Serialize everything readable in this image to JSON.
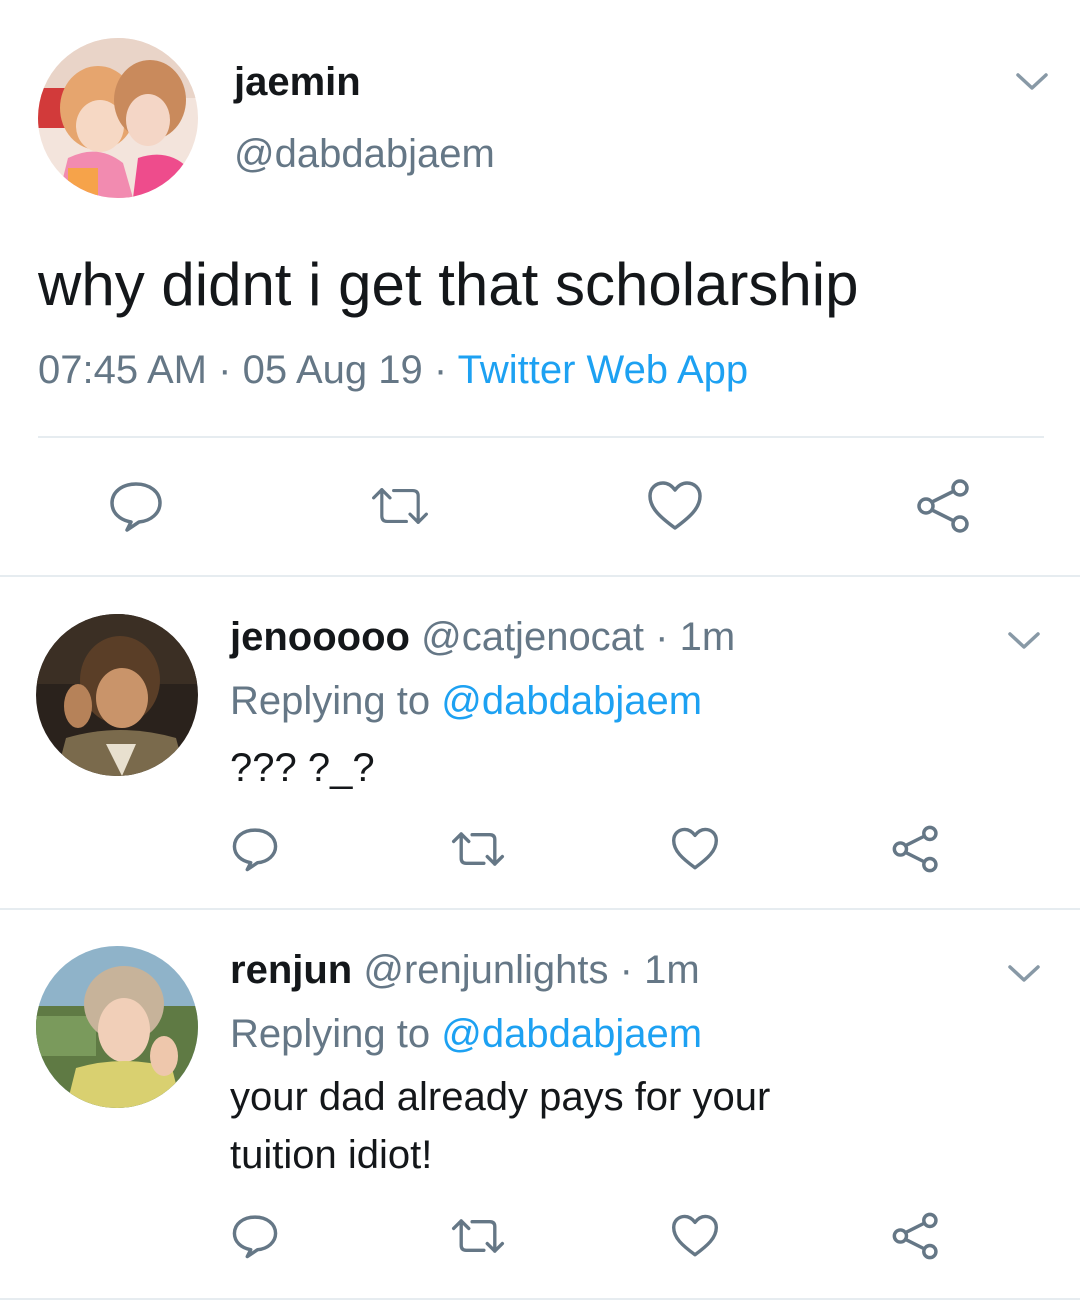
{
  "main_tweet": {
    "name": "jaemin",
    "handle": "@dabdabjaem",
    "text": "why didnt i get that scholarship",
    "time": "07:45 AM",
    "date": "05 Aug 19",
    "separator": "·",
    "source": "Twitter Web App",
    "avatar": "profile-photo"
  },
  "actions": {
    "reply_icon": "speech-bubble-icon",
    "retweet_icon": "retweet-icon",
    "like_icon": "heart-icon",
    "share_icon": "share-icon",
    "menu_icon": "chevron-down-icon"
  },
  "replies": [
    {
      "name": "jenooooo",
      "handle": "@catjenocat",
      "separator": "·",
      "time": "1m",
      "replying_prefix": "Replying to",
      "replying_to": "@dabdabjaem",
      "text": "??? ?_?"
    },
    {
      "name": "renjun",
      "handle": "@renjunlights",
      "separator": "·",
      "time": "1m",
      "replying_prefix": "Replying to",
      "replying_to": "@dabdabjaem",
      "text_lines": [
        "your dad already pays for your",
        "tuition idiot!"
      ]
    }
  ],
  "colors": {
    "text": "#14171a",
    "secondary": "#657786",
    "accent": "#1da1f2",
    "divider": "#e6ecf0"
  }
}
